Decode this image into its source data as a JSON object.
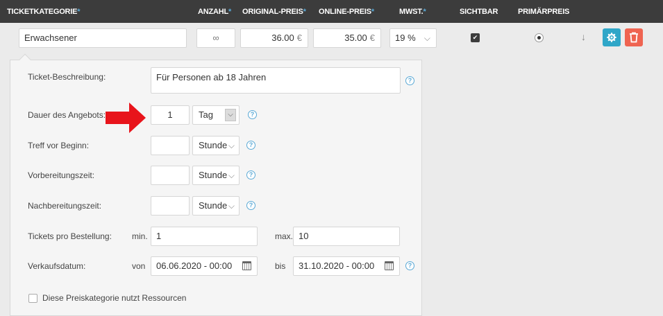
{
  "header": {
    "ticketkategorie": "TICKETKATEGORIE",
    "anzahl": "ANZAHL",
    "original_preis": "ORIGINAL-PREIS",
    "online_preis": "ONLINE-PREIS",
    "mwst": "MWST.",
    "sichtbar": "SICHTBAR",
    "primaerpreis": "PRIMÄRPREIS",
    "required_mark": "*"
  },
  "row": {
    "category": "Erwachsener",
    "count": "∞",
    "original_price": "36.00",
    "online_price": "35.00",
    "currency": "€",
    "vat": "19 %",
    "visible_checked": true,
    "primary_selected": true
  },
  "details": {
    "beschreibung_label": "Ticket-Beschreibung:",
    "beschreibung_value": "Für Personen ab 18 Jahren",
    "dauer_label": "Dauer des Angebots:",
    "dauer_value": "1",
    "dauer_unit": "Tag",
    "treff_label": "Treff vor Beginn:",
    "treff_value": "",
    "treff_unit": "Stunde",
    "vorbereitung_label": "Vorbereitungszeit:",
    "vorbereitung_value": "",
    "vorbereitung_unit": "Stunde",
    "nachbereitung_label": "Nachbereitungszeit:",
    "nachbereitung_value": "",
    "nachbereitung_unit": "Stunde",
    "tickets_label": "Tickets pro Bestellung:",
    "min_label": "min.",
    "min_value": "1",
    "max_label": "max.",
    "max_value": "10",
    "verkauf_label": "Verkaufsdatum:",
    "von_label": "von",
    "von_date": "06.06.2020",
    "von_time": "- 00:00",
    "bis_label": "bis",
    "bis_date": "31.10.2020",
    "bis_time": "- 00:00",
    "ressourcen_label": "Diese Preiskategorie nutzt Ressourcen"
  },
  "icons": {
    "help": "?",
    "chevron": "⌵",
    "down_arrow": "↓",
    "check": "✔"
  },
  "colors": {
    "header_bg": "#3c3c3c",
    "accent": "#2fa6c8",
    "danger": "#ef6451",
    "annotation_arrow": "#e8141b"
  }
}
